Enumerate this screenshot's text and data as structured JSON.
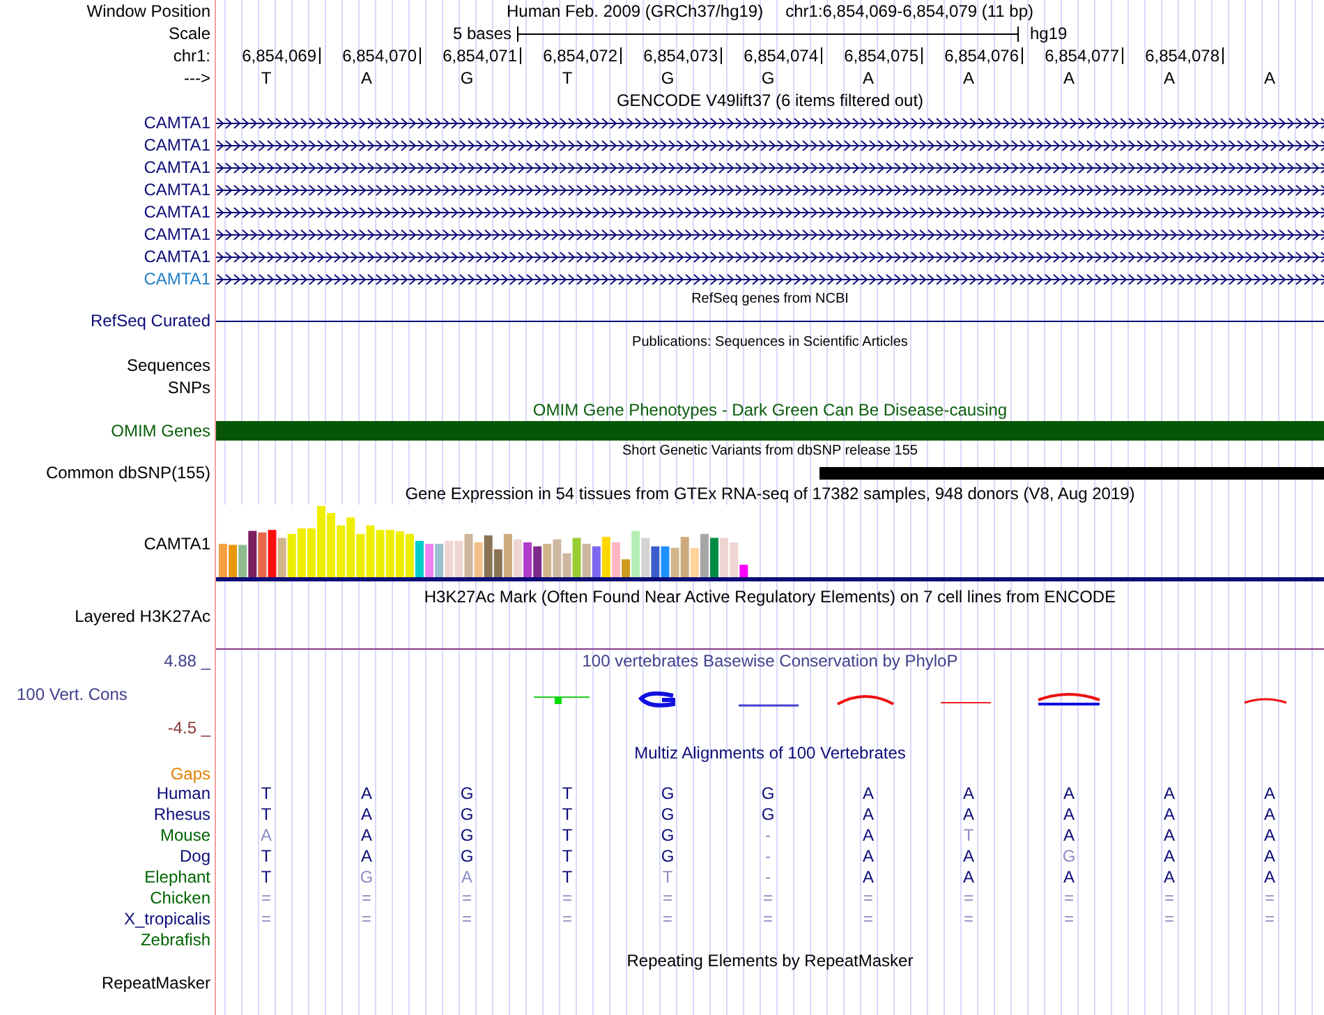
{
  "header": {
    "label": "Window Position",
    "assembly": "Human Feb. 2009 (GRCh37/hg19)",
    "position": "chr1:6,854,069-6,854,079 (11 bp)"
  },
  "scale": {
    "label": "Scale",
    "span": "5 bases",
    "genome": "hg19"
  },
  "ruler": {
    "label": "chr1:",
    "ticks": [
      "6,854,069",
      "6,854,070",
      "6,854,071",
      "6,854,072",
      "6,854,073",
      "6,854,074",
      "6,854,075",
      "6,854,076",
      "6,854,077",
      "6,854,078"
    ]
  },
  "sequence": {
    "label": "--->",
    "bases": [
      "T",
      "A",
      "G",
      "T",
      "G",
      "G",
      "A",
      "A",
      "A",
      "A",
      "A"
    ]
  },
  "gencode": {
    "title": "GENCODE V49lift37 (6 items filtered out)",
    "genes": [
      {
        "name": "CAMTA1",
        "color": "#0c0c78"
      },
      {
        "name": "CAMTA1",
        "color": "#0c0c78"
      },
      {
        "name": "CAMTA1",
        "color": "#0c0c78"
      },
      {
        "name": "CAMTA1",
        "color": "#0c0c78"
      },
      {
        "name": "CAMTA1",
        "color": "#0c0c78"
      },
      {
        "name": "CAMTA1",
        "color": "#0c0c78"
      },
      {
        "name": "CAMTA1",
        "color": "#0c0c78"
      },
      {
        "name": "CAMTA1",
        "color": "#1e7ec8"
      }
    ]
  },
  "refseq": {
    "title": "RefSeq genes from NCBI",
    "label": "RefSeq Curated"
  },
  "publications": {
    "title": "Publications: Sequences in Scientific Articles",
    "labels": [
      "Sequences",
      "SNPs"
    ]
  },
  "omim": {
    "title": "OMIM Gene Phenotypes - Dark Green Can Be Disease-causing",
    "label": "OMIM Genes"
  },
  "dbsnp": {
    "title": "Short Genetic Variants from dbSNP release 155",
    "label": "Common dbSNP(155)"
  },
  "gtex": {
    "title": "Gene Expression in 54 tissues from GTEx RNA-seq of 17382 samples, 948 donors (V8, Aug 2019)",
    "label": "CAMTA1"
  },
  "h3k27ac": {
    "title": "H3K27Ac Mark (Often Found Near Active Regulatory Elements) on 7 cell lines from ENCODE",
    "label": "Layered H3K27Ac"
  },
  "phylop": {
    "title": "100 vertebrates Basewise Conservation by PhyloP",
    "label": "100 Vert. Cons",
    "max": "4.88 _",
    "min": "-4.5 _"
  },
  "multiz": {
    "title": "Multiz Alignments of 100 Vertebrates",
    "gaps": "Gaps",
    "species": [
      {
        "name": "Human",
        "color": "#0c0c78",
        "bases": [
          {
            "base": "T",
            "faded": false
          },
          {
            "base": "A",
            "faded": false
          },
          {
            "base": "G",
            "faded": false
          },
          {
            "base": "T",
            "faded": false
          },
          {
            "base": "G",
            "faded": false
          },
          {
            "base": "G",
            "faded": false
          },
          {
            "base": "A",
            "faded": false
          },
          {
            "base": "A",
            "faded": false
          },
          {
            "base": "A",
            "faded": false
          },
          {
            "base": "A",
            "faded": false
          },
          {
            "base": "A",
            "faded": false
          }
        ]
      },
      {
        "name": "Rhesus",
        "color": "#0c0c78",
        "bases": [
          {
            "base": "T",
            "faded": false
          },
          {
            "base": "A",
            "faded": false
          },
          {
            "base": "G",
            "faded": false
          },
          {
            "base": "T",
            "faded": false
          },
          {
            "base": "G",
            "faded": false
          },
          {
            "base": "G",
            "faded": false
          },
          {
            "base": "A",
            "faded": false
          },
          {
            "base": "A",
            "faded": false
          },
          {
            "base": "A",
            "faded": false
          },
          {
            "base": "A",
            "faded": false
          },
          {
            "base": "A",
            "faded": false
          }
        ]
      },
      {
        "name": "Mouse",
        "color": "#006400",
        "bases": [
          {
            "base": "A",
            "faded": true
          },
          {
            "base": "A",
            "faded": false
          },
          {
            "base": "G",
            "faded": false
          },
          {
            "base": "T",
            "faded": false
          },
          {
            "base": "G",
            "faded": false
          },
          {
            "base": "-",
            "faded": true
          },
          {
            "base": "A",
            "faded": false
          },
          {
            "base": "T",
            "faded": true
          },
          {
            "base": "A",
            "faded": false
          },
          {
            "base": "A",
            "faded": false
          },
          {
            "base": "A",
            "faded": false
          }
        ]
      },
      {
        "name": "Dog",
        "color": "#0c0c78",
        "bases": [
          {
            "base": "T",
            "faded": false
          },
          {
            "base": "A",
            "faded": false
          },
          {
            "base": "G",
            "faded": false
          },
          {
            "base": "T",
            "faded": false
          },
          {
            "base": "G",
            "faded": false
          },
          {
            "base": "-",
            "faded": true
          },
          {
            "base": "A",
            "faded": false
          },
          {
            "base": "A",
            "faded": false
          },
          {
            "base": "G",
            "faded": true
          },
          {
            "base": "A",
            "faded": false
          },
          {
            "base": "A",
            "faded": false
          }
        ]
      },
      {
        "name": "Elephant",
        "color": "#006400",
        "bases": [
          {
            "base": "T",
            "faded": false
          },
          {
            "base": "G",
            "faded": true
          },
          {
            "base": "A",
            "faded": true
          },
          {
            "base": "T",
            "faded": false
          },
          {
            "base": "T",
            "faded": true
          },
          {
            "base": "-",
            "faded": true
          },
          {
            "base": "A",
            "faded": false
          },
          {
            "base": "A",
            "faded": false
          },
          {
            "base": "A",
            "faded": false
          },
          {
            "base": "A",
            "faded": false
          },
          {
            "base": "A",
            "faded": false
          }
        ]
      },
      {
        "name": "Chicken",
        "color": "#006400",
        "bases": [
          {
            "base": "=",
            "faded": true
          },
          {
            "base": "=",
            "faded": true
          },
          {
            "base": "=",
            "faded": true
          },
          {
            "base": "=",
            "faded": true
          },
          {
            "base": "=",
            "faded": true
          },
          {
            "base": "=",
            "faded": true
          },
          {
            "base": "=",
            "faded": true
          },
          {
            "base": "=",
            "faded": true
          },
          {
            "base": "=",
            "faded": true
          },
          {
            "base": "=",
            "faded": true
          },
          {
            "base": "=",
            "faded": true
          }
        ]
      },
      {
        "name": "X_tropicalis",
        "color": "#0c0c78",
        "bases": [
          {
            "base": "=",
            "faded": true
          },
          {
            "base": "=",
            "faded": true
          },
          {
            "base": "=",
            "faded": true
          },
          {
            "base": "=",
            "faded": true
          },
          {
            "base": "=",
            "faded": true
          },
          {
            "base": "=",
            "faded": true
          },
          {
            "base": "=",
            "faded": true
          },
          {
            "base": "=",
            "faded": true
          },
          {
            "base": "=",
            "faded": true
          },
          {
            "base": "=",
            "faded": true
          },
          {
            "base": "=",
            "faded": true
          }
        ]
      },
      {
        "name": "Zebrafish",
        "color": "#006400"
      }
    ]
  },
  "repeatmasker": {
    "title": "Repeating Elements by RepeatMasker",
    "label": "RepeatMasker"
  }
}
